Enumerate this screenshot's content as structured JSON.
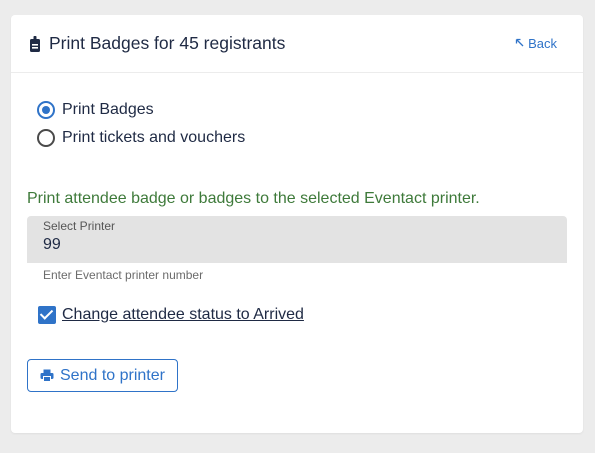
{
  "header": {
    "title": "Print Badges for 45 registrants",
    "back_label": "Back",
    "title_icon": "badge-icon",
    "back_icon": "arrow-up-left-icon"
  },
  "options": [
    {
      "label": "Print Badges",
      "selected": true
    },
    {
      "label": "Print tickets and vouchers",
      "selected": false
    }
  ],
  "description": "Print attendee badge or badges to the selected Eventact printer.",
  "printer_field": {
    "label": "Select Printer",
    "value": "99",
    "helper": "Enter Eventact printer number"
  },
  "status_checkbox": {
    "label": "Change attendee status to Arrived",
    "checked": true
  },
  "send_button": {
    "label": "Send to printer",
    "icon": "printer-icon"
  },
  "colors": {
    "accent": "#2f73c8",
    "description": "#3e7a3a",
    "field_bg": "#e3e3e3"
  }
}
